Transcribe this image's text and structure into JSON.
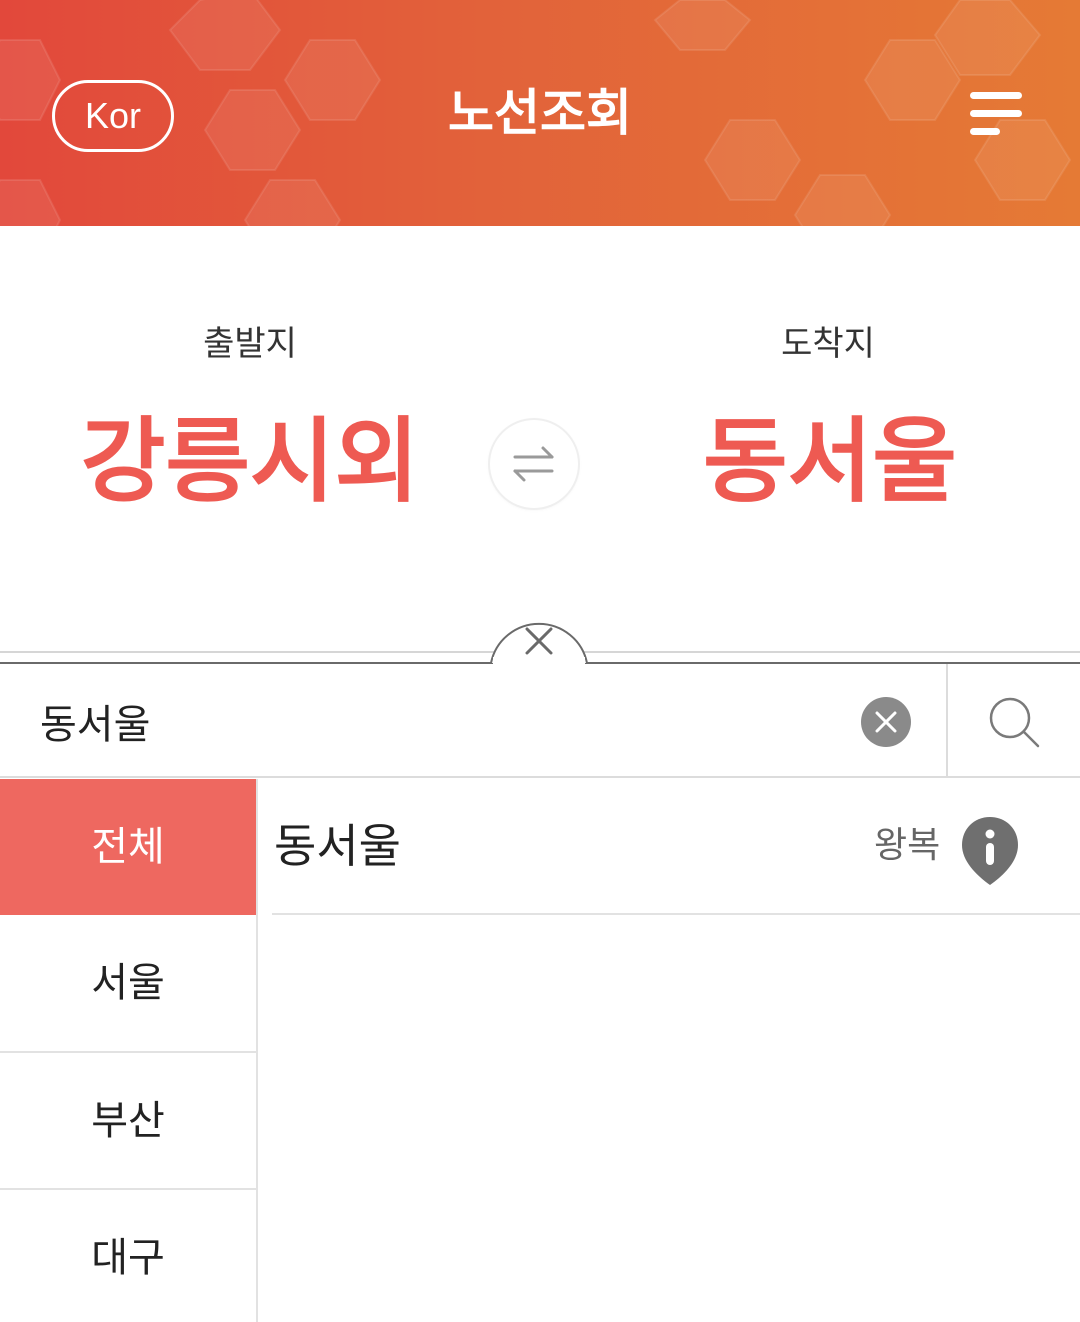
{
  "header": {
    "language_label": "Kor",
    "title": "노선조회",
    "menu_icon": "hamburger-menu-icon",
    "colors": {
      "gradient_start": "#e2483b",
      "gradient_end": "#e57a35"
    }
  },
  "route": {
    "departure_label": "출발지",
    "departure_value": "강릉시외",
    "arrival_label": "도착지",
    "arrival_value": "동서울",
    "swap_icon": "swap-arrows-icon",
    "value_color": "#ee5a52"
  },
  "panel": {
    "close_icon": "close-icon"
  },
  "search": {
    "value": "동서울",
    "clear_icon": "clear-circle-icon",
    "search_icon": "search-icon"
  },
  "regions": {
    "items": [
      {
        "label": "전체",
        "active": true
      },
      {
        "label": "서울",
        "active": false
      },
      {
        "label": "부산",
        "active": false
      },
      {
        "label": "대구",
        "active": false
      }
    ],
    "active_color": "#ee6860"
  },
  "results": [
    {
      "name": "동서울",
      "badge": "왕복",
      "info_icon": "info-pin-icon"
    }
  ]
}
